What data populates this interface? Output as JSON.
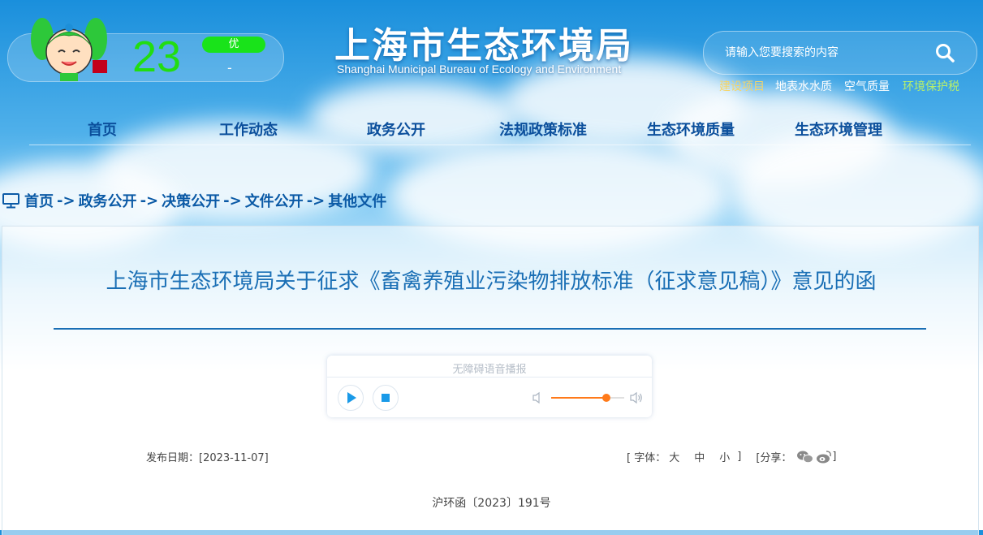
{
  "aqi": {
    "value": "23",
    "level": "优",
    "pollutant": "-"
  },
  "header": {
    "title": "上海市生态环境局",
    "subtitle": "Shanghai Municipal Bureau of Ecology and Environment"
  },
  "search": {
    "placeholder": "请输入您要搜索的内容"
  },
  "quick_links": [
    {
      "label": "建设项目",
      "color": "#f5d56a"
    },
    {
      "label": "地表水水质",
      "color": "#ffffff"
    },
    {
      "label": "空气质量",
      "color": "#ffffff"
    },
    {
      "label": "环境保护税",
      "color": "#b8f06a"
    }
  ],
  "nav": [
    "首页",
    "工作动态",
    "政务公开",
    "法规政策标准",
    "生态环境质量",
    "生态环境管理"
  ],
  "breadcrumb": {
    "home": "首页",
    "sep": "->",
    "items": [
      "政务公开",
      "决策公开",
      "文件公开",
      "其他文件"
    ]
  },
  "article": {
    "title": "上海市生态环境局关于征求《畜禽养殖业污染物排放标准（征求意见稿）》意见的函",
    "doc_number": "沪环函〔2023〕191号"
  },
  "player": {
    "label": "无障碍语音播报",
    "volume": 0.75
  },
  "meta": {
    "date_label": "发布日期：",
    "date": "[2023-11-07]",
    "font_prefix": "[ 字体：",
    "font_large": "大",
    "font_medium": "中",
    "font_small": "小",
    "font_suffix": "]",
    "share_prefix": "[分享：",
    "share_suffix": "]"
  },
  "colors": {
    "primary": "#1a6fb5",
    "nav_text": "#0b4f9c",
    "aqi_green": "#19e31a",
    "volume": "#ff7a1a"
  }
}
